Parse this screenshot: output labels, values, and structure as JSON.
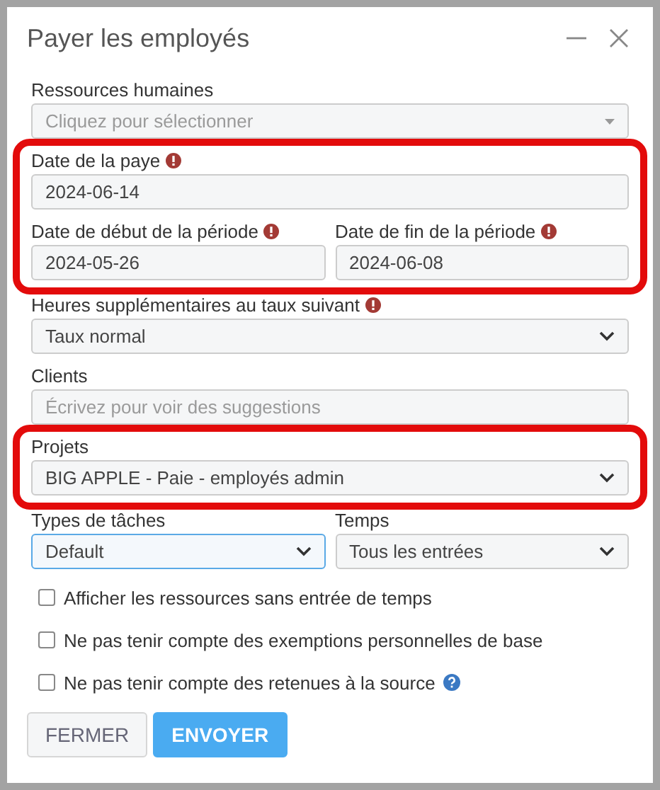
{
  "window": {
    "title": "Payer les employés"
  },
  "groups": [
    {
      "highlighted": false,
      "rows": [
        [
          {
            "label": "Ressources humaines",
            "kind": "dropdown",
            "placeholder": "Cliquez pour sélectionner",
            "alert": false,
            "focused": false
          }
        ]
      ]
    },
    {
      "highlighted": true,
      "rows": [
        [
          {
            "label": "Date de la paye",
            "kind": "text",
            "value": "2024-06-14",
            "alert": true,
            "focused": false
          }
        ],
        [
          {
            "label": "Date de début de la période",
            "kind": "text",
            "value": "2024-05-26",
            "alert": true,
            "focused": false
          },
          {
            "label": "Date de fin de la période",
            "kind": "text",
            "value": "2024-06-08",
            "alert": true,
            "focused": false
          }
        ]
      ]
    },
    {
      "highlighted": false,
      "rows": [
        [
          {
            "label": "Heures supplémentaires au taux suivant",
            "kind": "select",
            "value": "Taux normal",
            "alert": true,
            "focused": false
          }
        ],
        [
          {
            "label": "Clients",
            "kind": "text",
            "placeholder": "Écrivez pour voir des suggestions",
            "alert": false,
            "focused": false
          }
        ]
      ]
    },
    {
      "highlighted": true,
      "rows": [
        [
          {
            "label": "Projets",
            "kind": "select",
            "value": "BIG APPLE - Paie - employés admin",
            "alert": false,
            "focused": false
          }
        ]
      ]
    },
    {
      "highlighted": false,
      "rows": [
        [
          {
            "label": "Types de tâches",
            "kind": "select",
            "value": "Default",
            "alert": false,
            "focused": true
          },
          {
            "label": "Temps",
            "kind": "select",
            "value": "Tous les entrées",
            "alert": false,
            "focused": false
          }
        ]
      ]
    }
  ],
  "checkboxes": [
    {
      "label": "Afficher les ressources sans entrée de temps",
      "checked": false,
      "help": false
    },
    {
      "label": "Ne pas tenir compte des exemptions personnelles de base",
      "checked": false,
      "help": false
    },
    {
      "label": "Ne pas tenir compte des retenues à la source",
      "checked": false,
      "help": true
    }
  ],
  "buttons": [
    {
      "label": "FERMER",
      "kind": "secondary"
    },
    {
      "label": "ENVOYER",
      "kind": "primary"
    }
  ]
}
